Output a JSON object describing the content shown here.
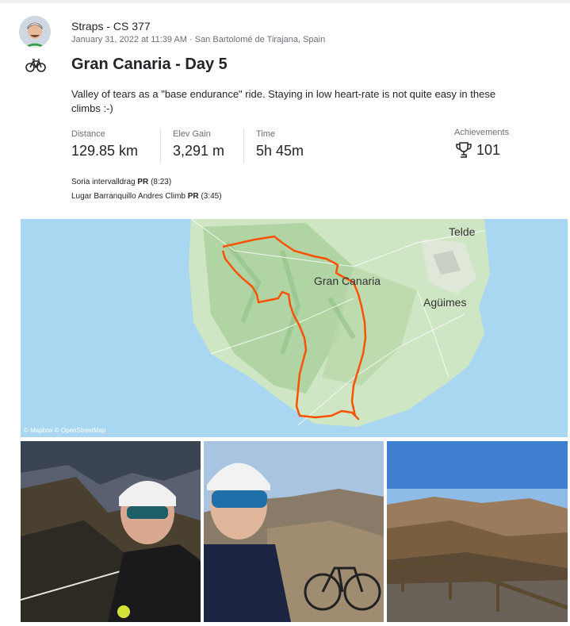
{
  "activity": {
    "athlete_name": "Straps - CS 377",
    "meta": "January 31, 2022 at 11:39 AM · San Bartolomé de Tirajana, Spain",
    "sport_icon": "bike-icon",
    "title": "Gran Canaria - Day 5",
    "description": "Valley of tears as a \"base endurance\" ride. Staying in low heart-rate is not quite easy in these climbs :-)"
  },
  "stats": {
    "distance": {
      "label": "Distance",
      "value": "129.85 km"
    },
    "elev_gain": {
      "label": "Elev Gain",
      "value": "3,291 m"
    },
    "time": {
      "label": "Time",
      "value": "5h 45m"
    },
    "achievements": {
      "label": "Achievements",
      "value": "101",
      "icon": "trophy-icon"
    }
  },
  "segments": [
    {
      "name": "Soria intervalldrag",
      "badge": "PR",
      "time": "(8:23)"
    },
    {
      "name": "Lugar Barranquillo Andres Climb",
      "badge": "PR",
      "time": "(3:45)"
    }
  ],
  "map": {
    "labels": {
      "telde": "Telde",
      "gran_canaria": "Gran Canaria",
      "aguimes": "Agüimes"
    },
    "attribution": "© Mapbox © OpenStreetMap",
    "route_color": "#fc5200"
  },
  "photos": [
    "photo-1",
    "photo-2",
    "photo-3"
  ]
}
